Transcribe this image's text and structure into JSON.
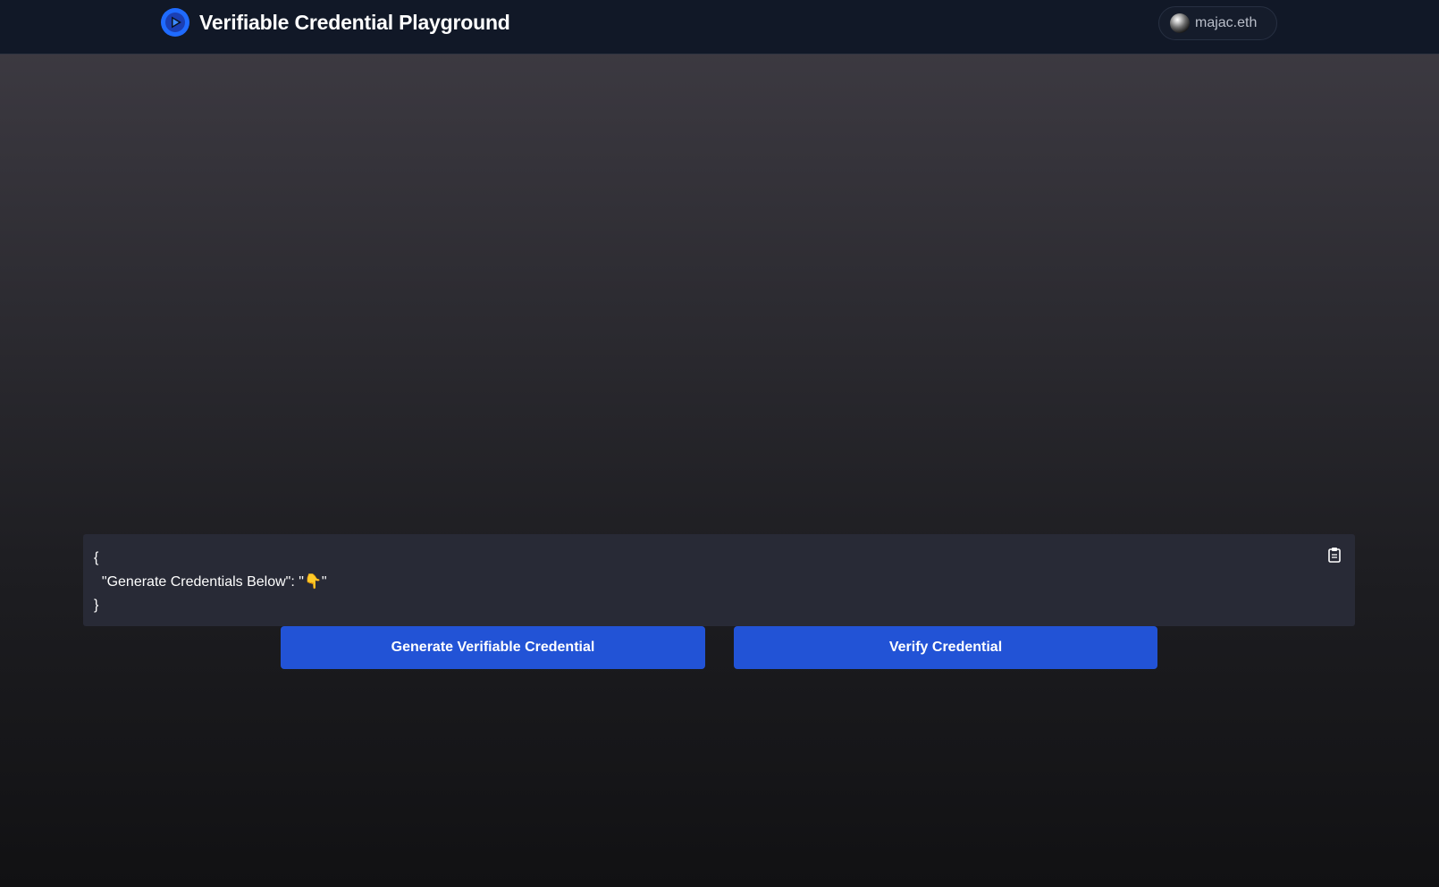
{
  "header": {
    "title": "Verifiable Credential Playground",
    "logo_icon": "play-logo-icon",
    "account": {
      "name": "majac.eth",
      "avatar_icon": "sphere-avatar-icon"
    }
  },
  "editor": {
    "lines": [
      "{",
      "  \"Generate Credentials Below\": \"",
      "\"",
      "}"
    ],
    "emoji": "👇",
    "copy_icon": "clipboard-icon"
  },
  "actions": {
    "generate_label": "Generate Verifiable Credential",
    "verify_label": "Verify Credential"
  },
  "colors": {
    "header_bg": "#111827",
    "button_bg": "#2253d6",
    "editor_bg": "#282a36",
    "logo_blue": "#1f6bff"
  }
}
